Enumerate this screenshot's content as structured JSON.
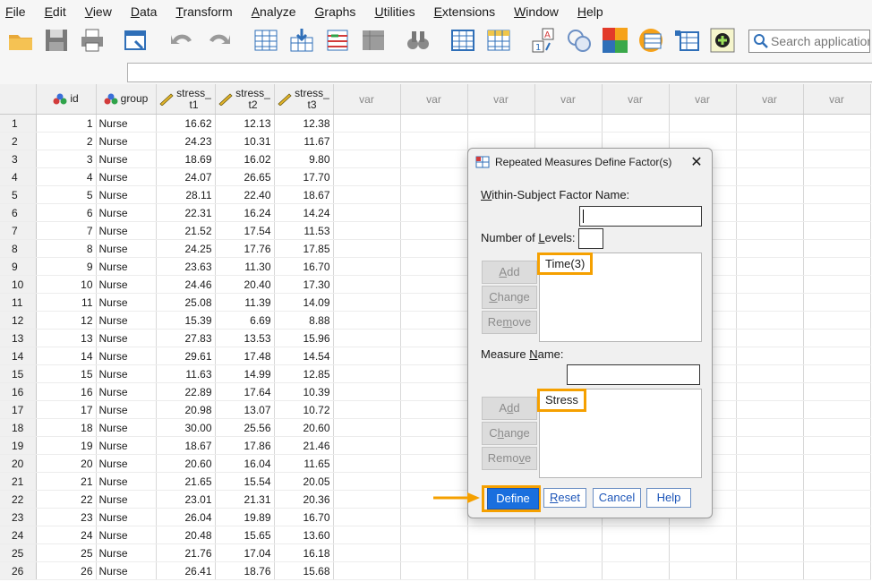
{
  "menu": [
    "File",
    "Edit",
    "View",
    "Data",
    "Transform",
    "Analyze",
    "Graphs",
    "Utilities",
    "Extensions",
    "Window",
    "Help"
  ],
  "search": {
    "placeholder": "Search application"
  },
  "grid": {
    "columns": [
      {
        "line1": "id",
        "line2": "",
        "type": "nominal"
      },
      {
        "line1": "group",
        "line2": "",
        "type": "nominal"
      },
      {
        "line1": "stress_",
        "line2": "t1",
        "type": "scale"
      },
      {
        "line1": "stress_",
        "line2": "t2",
        "type": "scale"
      },
      {
        "line1": "stress_",
        "line2": "t3",
        "type": "scale"
      }
    ],
    "var_label": "var",
    "rows": [
      [
        "1",
        "Nurse",
        "16.62",
        "12.13",
        "12.38"
      ],
      [
        "2",
        "Nurse",
        "24.23",
        "10.31",
        "11.67"
      ],
      [
        "3",
        "Nurse",
        "18.69",
        "16.02",
        "9.80"
      ],
      [
        "4",
        "Nurse",
        "24.07",
        "26.65",
        "17.70"
      ],
      [
        "5",
        "Nurse",
        "28.11",
        "22.40",
        "18.67"
      ],
      [
        "6",
        "Nurse",
        "22.31",
        "16.24",
        "14.24"
      ],
      [
        "7",
        "Nurse",
        "21.52",
        "17.54",
        "11.53"
      ],
      [
        "8",
        "Nurse",
        "24.25",
        "17.76",
        "17.85"
      ],
      [
        "9",
        "Nurse",
        "23.63",
        "11.30",
        "16.70"
      ],
      [
        "10",
        "Nurse",
        "24.46",
        "20.40",
        "17.30"
      ],
      [
        "11",
        "Nurse",
        "25.08",
        "11.39",
        "14.09"
      ],
      [
        "12",
        "Nurse",
        "15.39",
        "6.69",
        "8.88"
      ],
      [
        "13",
        "Nurse",
        "27.83",
        "13.53",
        "15.96"
      ],
      [
        "14",
        "Nurse",
        "29.61",
        "17.48",
        "14.54"
      ],
      [
        "15",
        "Nurse",
        "11.63",
        "14.99",
        "12.85"
      ],
      [
        "16",
        "Nurse",
        "22.89",
        "17.64",
        "10.39"
      ],
      [
        "17",
        "Nurse",
        "20.98",
        "13.07",
        "10.72"
      ],
      [
        "18",
        "Nurse",
        "30.00",
        "25.56",
        "20.60"
      ],
      [
        "19",
        "Nurse",
        "18.67",
        "17.86",
        "21.46"
      ],
      [
        "20",
        "Nurse",
        "20.60",
        "16.04",
        "11.65"
      ],
      [
        "21",
        "Nurse",
        "21.65",
        "15.54",
        "20.05"
      ],
      [
        "22",
        "Nurse",
        "23.01",
        "21.31",
        "20.36"
      ],
      [
        "23",
        "Nurse",
        "26.04",
        "19.89",
        "16.70"
      ],
      [
        "24",
        "Nurse",
        "20.48",
        "15.65",
        "13.60"
      ],
      [
        "25",
        "Nurse",
        "21.76",
        "17.04",
        "16.18"
      ],
      [
        "26",
        "Nurse",
        "26.41",
        "18.76",
        "15.68"
      ]
    ]
  },
  "dialog": {
    "title": "Repeated Measures Define Factor(s)",
    "factor_name_label": "Within-Subject Factor Name:",
    "levels_label": "Number of Levels:",
    "factor_list": [
      "Time(3)"
    ],
    "measure_name_label": "Measure Name:",
    "measure_list": [
      "Stress"
    ],
    "add_label": "Add",
    "change_label": "Change",
    "remove_label": "Remove",
    "define_label": "Define",
    "reset_label": "Reset",
    "cancel_label": "Cancel",
    "help_label": "Help"
  },
  "colors": {
    "highlight": "#f5a000",
    "primary_button": "#1a6fde"
  }
}
